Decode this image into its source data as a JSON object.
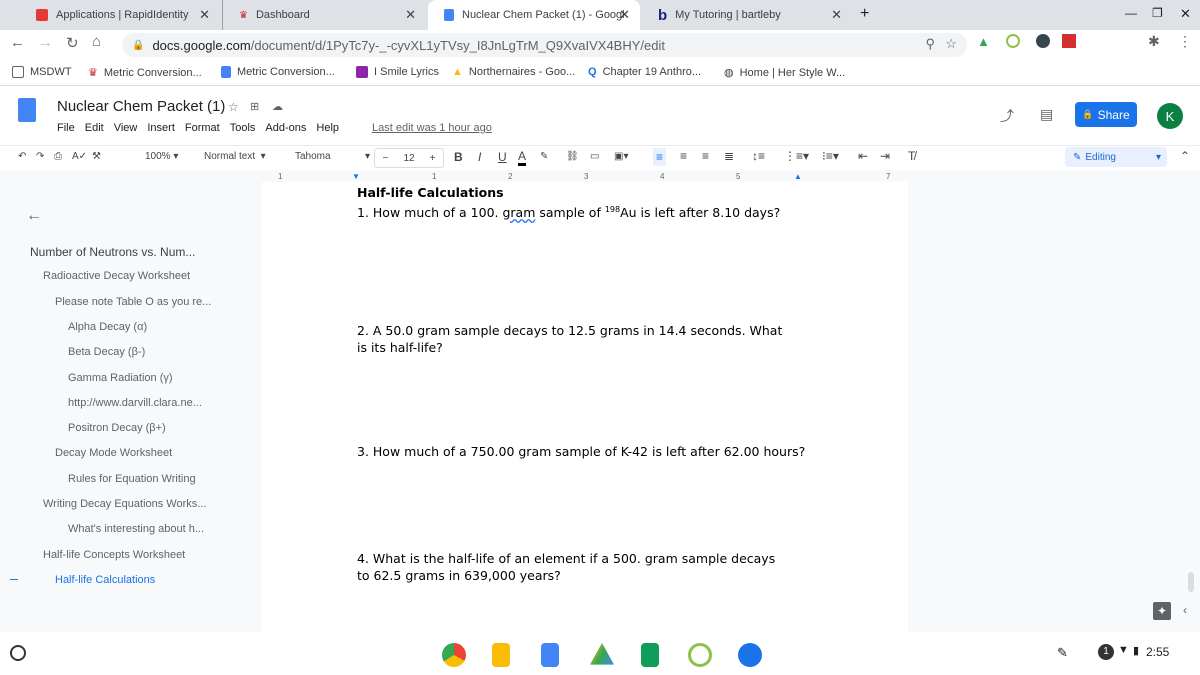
{
  "browser": {
    "tabs": [
      {
        "label": "Applications | RapidIdentity",
        "icon": "rapididentity-icon",
        "active": false
      },
      {
        "label": "Dashboard",
        "icon": "dashboard-icon",
        "active": false
      },
      {
        "label": "Nuclear Chem Packet (1) - Googl",
        "icon": "google-docs-icon",
        "active": true
      },
      {
        "label": "My Tutoring | bartleby",
        "icon": "bartleby-icon",
        "active": false
      }
    ],
    "url_domain": "docs.google.com",
    "url_path": "/document/d/1PyTc7y-_-cyvXL1yTVsy_I8JnLgTrM_Q9XvaIVX4BHY/edit",
    "bookmarks": [
      "MSDWT",
      "Metric Conversion...",
      "Metric Conversion...",
      "I Smile Lyrics",
      "Northernaires - Goo...",
      "Chapter 19 Anthro...",
      "Home | Her Style W..."
    ]
  },
  "doc": {
    "title": "Nuclear Chem Packet (1)",
    "menu": [
      "File",
      "Edit",
      "View",
      "Insert",
      "Format",
      "Tools",
      "Add-ons",
      "Help"
    ],
    "last_edit": "Last edit was 1 hour ago",
    "share": "Share",
    "avatar": "K",
    "toolbar": {
      "zoom": "100%",
      "style": "Normal text",
      "font": "Tahoma",
      "size": "12",
      "mode": "Editing"
    },
    "ruler": [
      "1",
      "1",
      "2",
      "3",
      "4",
      "5",
      "7"
    ]
  },
  "outline": [
    {
      "label": "Number of Neutrons vs. Num...",
      "level": 0
    },
    {
      "label": "Radioactive Decay Worksheet",
      "level": 1
    },
    {
      "label": "Please note Table O as you re...",
      "level": 2
    },
    {
      "label": "Alpha Decay (α)",
      "level": 3
    },
    {
      "label": "Beta Decay (β-)",
      "level": 3
    },
    {
      "label": "Gamma Radiation (γ)",
      "level": 3
    },
    {
      "label": "http://www.darvill.clara.ne...",
      "level": 3
    },
    {
      "label": "Positron Decay (β+)",
      "level": 3
    },
    {
      "label": "Decay Mode Worksheet",
      "level": 2
    },
    {
      "label": "Rules for Equation Writing",
      "level": 3
    },
    {
      "label": "Writing Decay Equations Works...",
      "level": 1
    },
    {
      "label": "What's interesting about h...",
      "level": 3
    },
    {
      "label": "Half-life Concepts Worksheet",
      "level": 1
    },
    {
      "label": "Half-life Calculations",
      "level": 2,
      "active": true
    }
  ],
  "content": {
    "heading": "Half-life Calculations",
    "q1_pre": "1.  How much of a 100. ",
    "q1_gram": "gram",
    "q1_mid": " sample of ",
    "q1_sup": "198",
    "q1_post": "Au is left after 8.10 days?",
    "q2": "2.  A 50.0 gram sample decays to 12.5 grams in 14.4 seconds.  What is its half-life?",
    "q3": "3.  How much of a 750.00 gram sample of K-42 is left after 62.00 hours?",
    "q4": "4.  What is the half-life of an element if a 500. gram sample decays to 62.5 grams in 639,000 years?"
  },
  "status": {
    "time": "2:55",
    "notification_count": "1"
  },
  "colors": {
    "accent": "#1a73e8",
    "avatar": "#0b8043",
    "outline_active": "#1a73e8"
  }
}
